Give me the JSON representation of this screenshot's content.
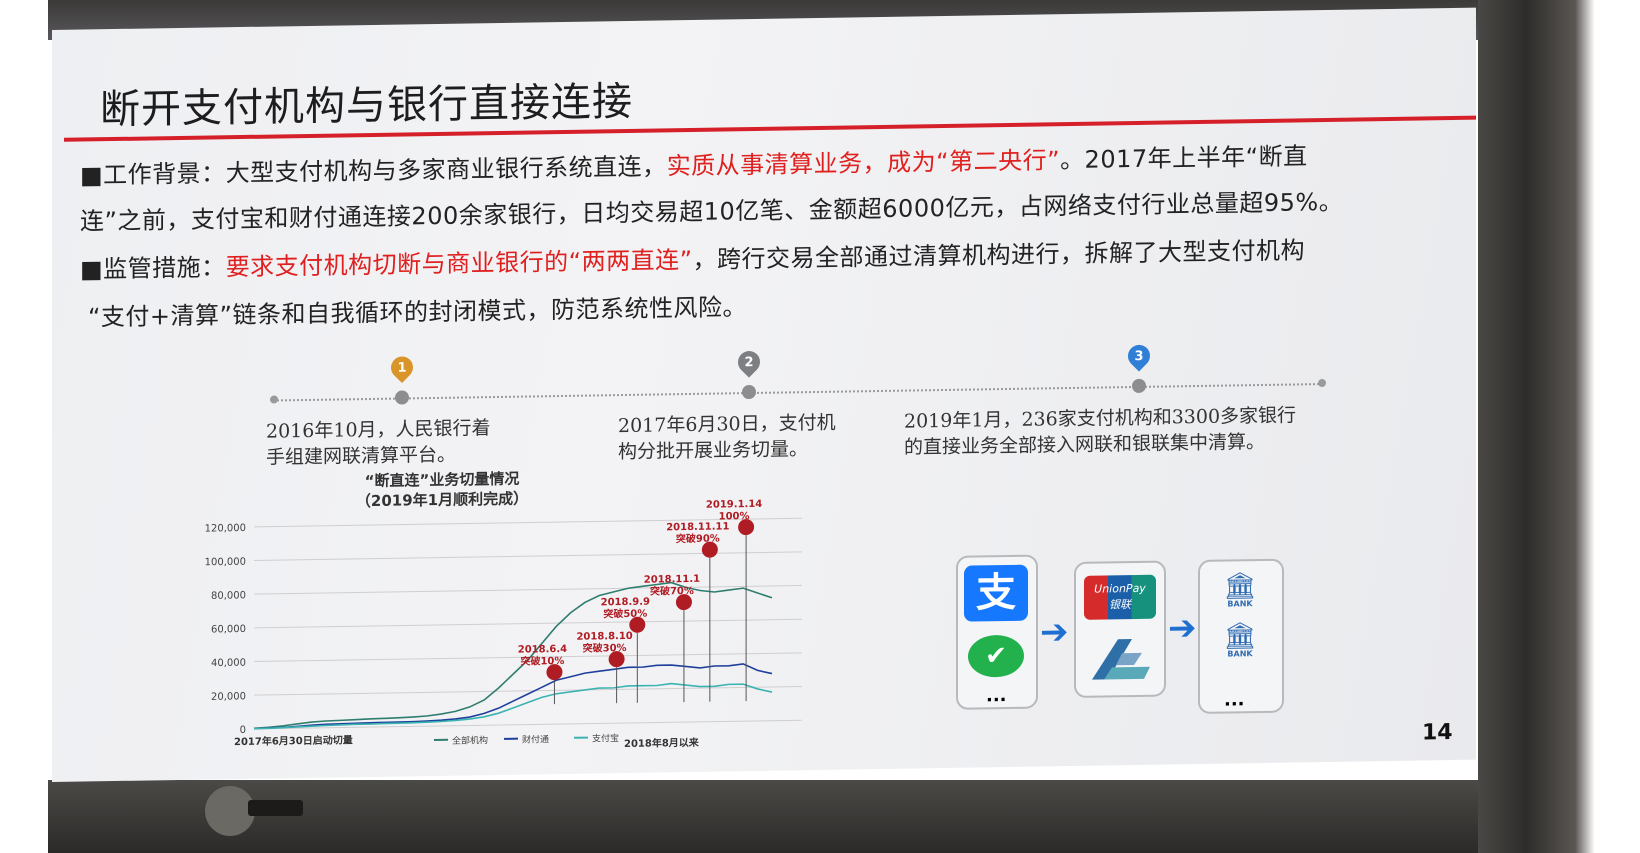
{
  "slide": {
    "title": "断开支付机构与银行直接连接",
    "page_number": "14"
  },
  "background": {
    "label": "■工作背景：",
    "text1": "大型支付机构与多家商业银行系统直连，",
    "highlight": "实质从事清算业务，成为“第二央行”",
    "text2": "。2017年上半年“断直",
    "line2": "连”之前，支付宝和财付通连接200余家银行，日均交易超10亿笔、金额超6000亿元，占网络支付行业总量超95%。"
  },
  "measures": {
    "label": "■监管措施：",
    "highlight": "要求支付机构切断与商业银行的“两两直连”",
    "text1": "，跨行交易全部通过清算机构进行，拆解了大型支付机构",
    "line2": "“支付+清算”链条和自我循环的封闭模式，防范系统性风险。"
  },
  "timeline": [
    {
      "num": "1",
      "color": "#d9952a",
      "text_line1": "2016年10月，人民银行着",
      "text_line2": "手组建网联清算平台。"
    },
    {
      "num": "2",
      "color": "#7d7f83",
      "text_line1": "2017年6月30日，支付机",
      "text_line2": "构分批开展业务切量。"
    },
    {
      "num": "3",
      "color": "#2f7fd6",
      "text_line1": "2019年1月，236家支付机构和3300多家银行",
      "text_line2": "的直接业务全部接入网联和银联集中清算。"
    }
  ],
  "chart_data": {
    "type": "line",
    "title": "“断直连”业务切量情况",
    "subtitle": "（2019年1月顺利完成）",
    "xlabel_left": "2017年6月30日启动切量",
    "xlabel_right": "2018年8月以来",
    "ylim": [
      0,
      120000
    ],
    "y_ticks": [
      "0",
      "20,000",
      "40,000",
      "60,000",
      "80,000",
      "100,000",
      "120,000"
    ],
    "series": [
      {
        "name": "全部机构",
        "color": "#2e7d6e",
        "values": [
          300,
          800,
          1500,
          2500,
          3500,
          4000,
          4200,
          4500,
          4800,
          5000,
          5200,
          5500,
          6000,
          7000,
          8500,
          11000,
          15000,
          22000,
          30000,
          38000,
          48000,
          58000,
          66000,
          72000,
          76000,
          78000,
          80000,
          81000,
          82000,
          83000,
          80000,
          78000,
          77000,
          78000,
          79000,
          76000,
          73000
        ]
      },
      {
        "name": "财付通",
        "color": "#1f3f9c",
        "values": [
          100,
          300,
          600,
          1000,
          1600,
          2000,
          2200,
          2400,
          2500,
          2600,
          2700,
          2800,
          3000,
          3400,
          4000,
          5000,
          7000,
          10000,
          14000,
          18000,
          22000,
          26000,
          28000,
          30000,
          31000,
          32000,
          33000,
          33000,
          34000,
          34000,
          33000,
          32000,
          33000,
          33000,
          34000,
          30000,
          28000
        ]
      },
      {
        "name": "支付宝",
        "color": "#3bb3b0",
        "values": [
          100,
          200,
          400,
          700,
          1000,
          1300,
          1500,
          1700,
          1800,
          1900,
          2000,
          2100,
          2300,
          2600,
          3100,
          3800,
          5000,
          7000,
          10000,
          13000,
          16000,
          18000,
          19000,
          20000,
          21000,
          21000,
          22000,
          22000,
          22000,
          23000,
          22000,
          21000,
          21000,
          22000,
          22000,
          19000,
          17000
        ]
      }
    ],
    "milestones": [
      {
        "date": "2018.6.4",
        "label": "突破10%"
      },
      {
        "date": "2018.8.10",
        "label": "突破30%"
      },
      {
        "date": "2018.9.9",
        "label": "突破50%"
      },
      {
        "date": "2018.11.1",
        "label": "突破70%"
      },
      {
        "date": "2018.11.11",
        "label": "突破90%"
      },
      {
        "date": "2019.1.14",
        "label": "100%"
      }
    ]
  },
  "flow": {
    "left_icons": [
      "alipay-icon",
      "wechat-pay-icon"
    ],
    "middle_icons": [
      "unionpay-icon",
      "nucc-icon"
    ],
    "right_icons": [
      "bank-icon",
      "bank-icon"
    ],
    "bank_label": "BANK",
    "unionpay_label": "UnionPay",
    "unionpay_cn": "银联",
    "ellipsis": "..."
  }
}
